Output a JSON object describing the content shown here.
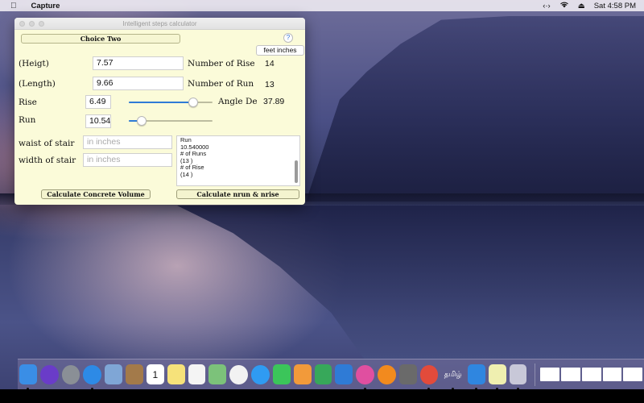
{
  "menubar": {
    "apple_icon": "apple-logo",
    "app_name": "Capture",
    "status_icons": [
      "code-brackets-icon",
      "wifi-icon",
      "eject-icon"
    ],
    "clock": "Sat 4:58 PM"
  },
  "window": {
    "title": "Intelligent steps calculator",
    "choice_button": "Choice Two",
    "help_button": "?",
    "unit_button": "feet inches",
    "height_label": "(Heigt)",
    "height_value": "7.57",
    "length_label": "(Length)",
    "length_value": "9.66",
    "num_rise_label": "Number of Rise",
    "num_rise_value": "14",
    "num_run_label": "Number of Run",
    "num_run_value": "13",
    "rise_label": "Rise",
    "rise_value": "6.49",
    "rise_slider_fraction": 0.77,
    "angle_label": "Angle De",
    "angle_value": "37.89",
    "run_label": "Run",
    "run_value": "10.54",
    "run_slider_fraction": 0.15,
    "waist_label": "waist of stair",
    "waist_placeholder": "in inches",
    "width_label": "width of stair",
    "width_placeholder": "in inches",
    "results_lines": [
      "Run",
      "10.540000",
      "# of Runs",
      "(13  )",
      "# of Rise",
      "(14  )"
    ],
    "calc_concrete_button": "Calculate Concrete Volume",
    "calc_nrun_button": "Calculate nrun & nrise"
  },
  "dock": {
    "apps": [
      {
        "name": "Finder",
        "icon": "finder-icon",
        "color": "#3a8ee6",
        "running": true
      },
      {
        "name": "Siri",
        "icon": "siri-icon",
        "color": "#6a3cc8",
        "running": false
      },
      {
        "name": "Launchpad",
        "icon": "rocket-icon",
        "color": "#8a8f96",
        "running": false
      },
      {
        "name": "Safari",
        "icon": "compass-icon",
        "color": "#2d8ae6",
        "running": true
      },
      {
        "name": "Preview",
        "icon": "preview-icon",
        "color": "#7fa6d6",
        "running": false
      },
      {
        "name": "Contacts",
        "icon": "contacts-icon",
        "color": "#a37a4a",
        "running": false
      },
      {
        "name": "Calendar",
        "icon": "calendar-icon",
        "color": "#ffffff",
        "running": false,
        "label": "1"
      },
      {
        "name": "Notes",
        "icon": "notes-icon",
        "color": "#f6e27a",
        "running": false
      },
      {
        "name": "Reminders",
        "icon": "reminders-icon",
        "color": "#f4f4f4",
        "running": false
      },
      {
        "name": "Maps",
        "icon": "maps-icon",
        "color": "#7cc27a",
        "running": false
      },
      {
        "name": "Photos",
        "icon": "photos-icon",
        "color": "#f2f2f2",
        "running": false
      },
      {
        "name": "Messages",
        "icon": "messages-icon",
        "color": "#2f9bf2",
        "running": false
      },
      {
        "name": "FaceTime",
        "icon": "facetime-icon",
        "color": "#3bc55a",
        "running": false
      },
      {
        "name": "Pages",
        "icon": "pages-icon",
        "color": "#f29a3a",
        "running": false
      },
      {
        "name": "Numbers",
        "icon": "numbers-icon",
        "color": "#37a85a",
        "running": false
      },
      {
        "name": "Keynote",
        "icon": "keynote-icon",
        "color": "#2f7bd6",
        "running": false
      },
      {
        "name": "iTunes",
        "icon": "music-icon",
        "color": "#e04fa0",
        "running": true
      },
      {
        "name": "iBooks",
        "icon": "books-icon",
        "color": "#f28a1e",
        "running": false
      },
      {
        "name": "System Preferences",
        "icon": "gear-icon",
        "color": "#6a6a6a",
        "running": false
      },
      {
        "name": "Chrome",
        "icon": "chrome-icon",
        "color": "#e24b3b",
        "running": true
      },
      {
        "name": "Tamil",
        "icon": "tamil-text-icon",
        "color": "transparent",
        "running": true,
        "label": "தமிழ்"
      },
      {
        "name": "Xcode",
        "icon": "hammer-icon",
        "color": "#2f86e0",
        "running": true
      },
      {
        "name": "Intelligent Steps Calculator",
        "icon": "stairs-app-icon",
        "color": "#efefb0",
        "running": true
      },
      {
        "name": "Java",
        "icon": "java-icon",
        "color": "#c8c8d8",
        "running": true
      }
    ],
    "thumbnails": [
      "downloads-stack",
      "minimized-window-1",
      "minimized-window-2",
      "minimized-window-3",
      "minimized-window-4"
    ]
  }
}
